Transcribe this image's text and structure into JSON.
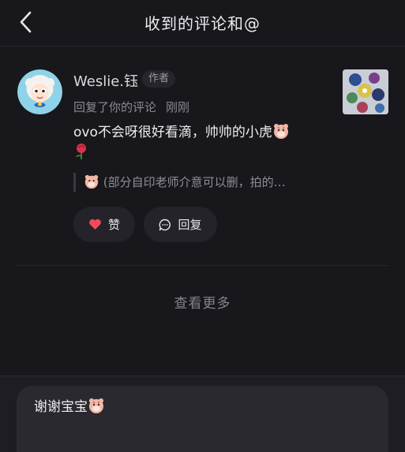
{
  "header": {
    "title": "收到的评论和@"
  },
  "comment": {
    "username": "Weslie.钰",
    "badge": "作者",
    "action": "回复了你的评论",
    "time": "刚刚",
    "text": "ovo不会呀很好看滴，帅帅的小虎",
    "quote": "(部分自印老师介意可以删，拍的…",
    "like_label": "赞",
    "reply_label": "回复",
    "like_color": "#f04a5e"
  },
  "more_label": "查看更多",
  "input": {
    "value": "谢谢宝宝"
  }
}
